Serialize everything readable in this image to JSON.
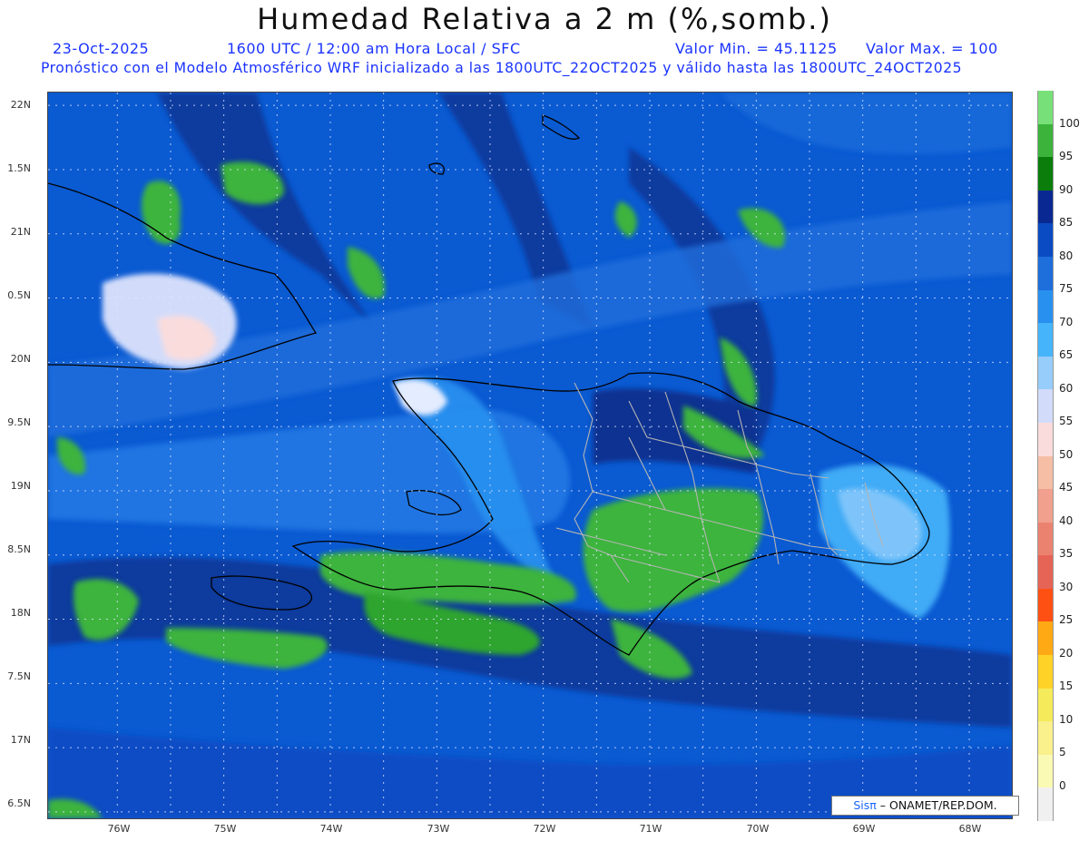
{
  "header": {
    "title": "Humedad Relativa a 2 m (%,somb.)",
    "date": "23-Oct-2025",
    "time_info": "1600 UTC / 12:00 am Hora Local / SFC",
    "min_value": "Valor Min. = 45.1125",
    "max_value": "Valor Max. = 100",
    "model_info": "Pronóstico con el Modelo Atmosférico WRF inicializado a las 1800UTC_22OCT2025 y válido hasta las  1800UTC_24OCT2025"
  },
  "map": {
    "lat_labels": [
      "22N",
      "1.5N",
      "21N",
      "0.5N",
      "20N",
      "9.5N",
      "19N",
      "8.5N",
      "18N",
      "7.5N",
      "17N",
      "6.5N"
    ],
    "lon_labels": [
      "76W",
      "75W",
      "74W",
      "73W",
      "72W",
      "71W",
      "70W",
      "69W",
      "68W"
    ],
    "lon_range": [
      -76.65,
      -67.6
    ],
    "lat_range": [
      16.45,
      22.1
    ],
    "background_color": "#0a5ad2"
  },
  "colorbar": {
    "labels": [
      "100",
      "95",
      "90",
      "85",
      "80",
      "75",
      "70",
      "65",
      "60",
      "55",
      "50",
      "45",
      "40",
      "35",
      "30",
      "25",
      "20",
      "15",
      "10",
      "5",
      "0"
    ],
    "colors": [
      "#78e078",
      "#3cb43c",
      "#0a7d0a",
      "#0a2891",
      "#0a4bc3",
      "#1e6edc",
      "#2891f0",
      "#46b4fa",
      "#96cdfa",
      "#d2dcfa",
      "#fadcdc",
      "#f5bea5",
      "#f0a08c",
      "#eb8270",
      "#e66455",
      "#ff5014",
      "#ffaa14",
      "#ffd228",
      "#f5eb5a",
      "#faf08c",
      "#fafab4",
      "#f0f0f0"
    ]
  },
  "credit": {
    "sis": "Sisπ",
    "org": "– ONAMET/REP.DOM."
  }
}
